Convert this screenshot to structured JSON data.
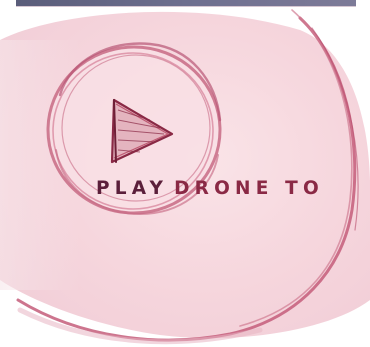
{
  "title": {
    "word1": "PLAY",
    "word2": "DRONE TO"
  },
  "icon": "play-icon",
  "colors": {
    "background": "#ffffff",
    "blush": "#f6d9df",
    "ring": "#c86b85",
    "accent_dark": "#5b1f3a",
    "accent": "#8a2945",
    "top_bar": "#6e6f8f"
  }
}
